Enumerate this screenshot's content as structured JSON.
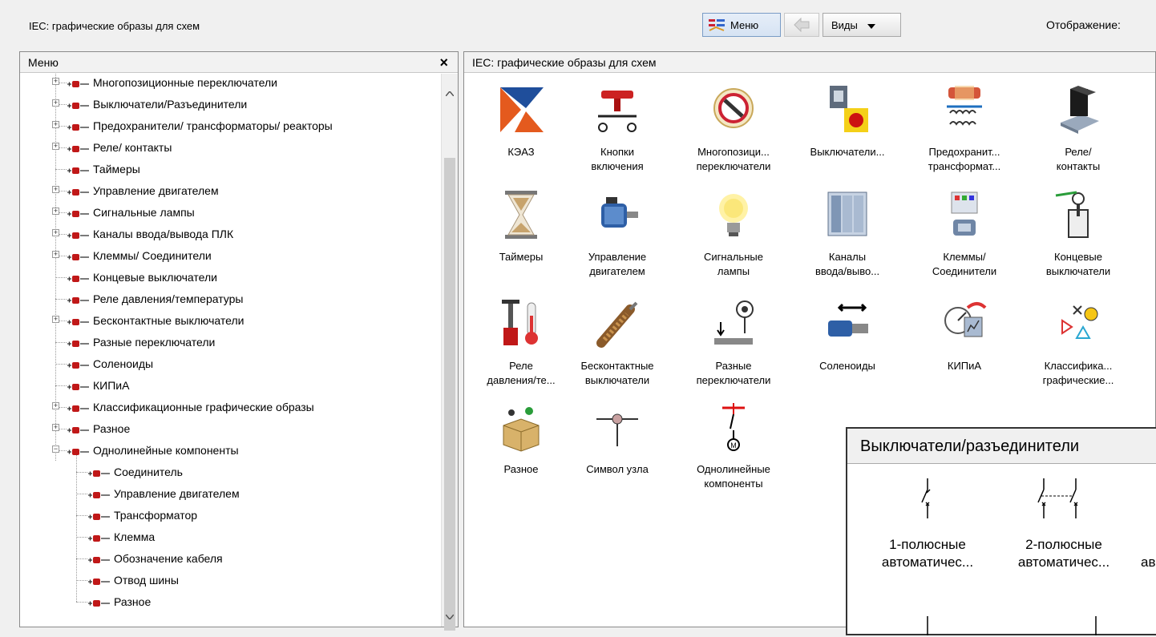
{
  "app": {
    "title": "IEC: графические образы для схем",
    "toolbar": {
      "menu_label": "Меню",
      "views_label": "Виды",
      "display_label": "Отображение:"
    }
  },
  "menu_panel": {
    "title": "Меню",
    "close_glyph": "×",
    "items": [
      {
        "label": "Многопозиционные переключатели",
        "expander": "+"
      },
      {
        "label": "Выключатели/Разъединители",
        "expander": "+"
      },
      {
        "label": "Предохранители/ трансформаторы/ реакторы",
        "expander": "+"
      },
      {
        "label": "Реле/ контакты",
        "expander": "+"
      },
      {
        "label": "Таймеры",
        "expander": ""
      },
      {
        "label": "Управление двигателем",
        "expander": "+"
      },
      {
        "label": "Сигнальные лампы",
        "expander": "+"
      },
      {
        "label": "Каналы ввода/вывода ПЛК",
        "expander": "+"
      },
      {
        "label": "Клеммы/ Соединители",
        "expander": "+"
      },
      {
        "label": "Концевые выключатели",
        "expander": ""
      },
      {
        "label": "Реле давления/температуры",
        "expander": ""
      },
      {
        "label": "Бесконтактные выключатели",
        "expander": "+"
      },
      {
        "label": "Разные переключатели",
        "expander": ""
      },
      {
        "label": "Соленоиды",
        "expander": ""
      },
      {
        "label": "КИПиА",
        "expander": ""
      },
      {
        "label": "Классификационные графические образы",
        "expander": "+"
      },
      {
        "label": "Разное",
        "expander": "+"
      },
      {
        "label": "Однолинейные компоненты",
        "expander": "−"
      }
    ],
    "subitems": [
      "Соединитель",
      "Управление двигателем",
      "Трансформатор",
      "Клемма",
      "Обозначение кабеля",
      "Отвод шины",
      "Разное"
    ]
  },
  "content_panel": {
    "title": "IEC: графические образы для схем",
    "icons": [
      {
        "line1": "КЭАЗ",
        "line2": "",
        "icon": "keaz-logo-icon"
      },
      {
        "line1": "Кнопки",
        "line2": "включения",
        "icon": "push-button-icon"
      },
      {
        "line1": "Многопозици...",
        "line2": "переключатели",
        "icon": "multiposition-switch-icon"
      },
      {
        "line1": "Выключатели...",
        "line2": "",
        "icon": "disconnect-switch-icon"
      },
      {
        "line1": "Предохранит...",
        "line2": "трансформат...",
        "icon": "fuse-transformer-icon"
      },
      {
        "line1": "Реле/",
        "line2": "контакты",
        "icon": "relay-icon"
      },
      {
        "line1": "Таймеры",
        "line2": "",
        "icon": "hourglass-icon"
      },
      {
        "line1": "Управление",
        "line2": "двигателем",
        "icon": "motor-icon"
      },
      {
        "line1": "Сигнальные",
        "line2": "лампы",
        "icon": "lamp-icon"
      },
      {
        "line1": "Каналы",
        "line2": "ввода/выво...",
        "icon": "plc-io-icon"
      },
      {
        "line1": "Клеммы/",
        "line2": "Соединители",
        "icon": "terminal-icon"
      },
      {
        "line1": "Концевые",
        "line2": "выключатели",
        "icon": "limit-switch-icon"
      },
      {
        "line1": "Реле",
        "line2": "давления/те...",
        "icon": "pressure-temp-icon"
      },
      {
        "line1": "Бесконтактные",
        "line2": "выключатели",
        "icon": "proximity-switch-icon"
      },
      {
        "line1": "Разные",
        "line2": "переключатели",
        "icon": "misc-switch-icon"
      },
      {
        "line1": "Соленоиды",
        "line2": "",
        "icon": "solenoid-icon"
      },
      {
        "line1": "КИПиА",
        "line2": "",
        "icon": "gauge-icon"
      },
      {
        "line1": "Классифика...",
        "line2": "графические...",
        "icon": "classification-icon"
      },
      {
        "line1": "Разное",
        "line2": "",
        "icon": "misc-box-icon"
      },
      {
        "line1": "Символ узла",
        "line2": "",
        "icon": "node-symbol-icon"
      },
      {
        "line1": "Однолинейные",
        "line2": "компоненты",
        "icon": "single-line-icon"
      }
    ]
  },
  "popup": {
    "title": "Выключатели/разъединители",
    "items": [
      {
        "line1": "1-полюсные",
        "line2": "автоматичес..."
      },
      {
        "line1": "2-полюсные",
        "line2": "автоматичес..."
      },
      {
        "line1": "",
        "line2": "ав"
      }
    ]
  }
}
